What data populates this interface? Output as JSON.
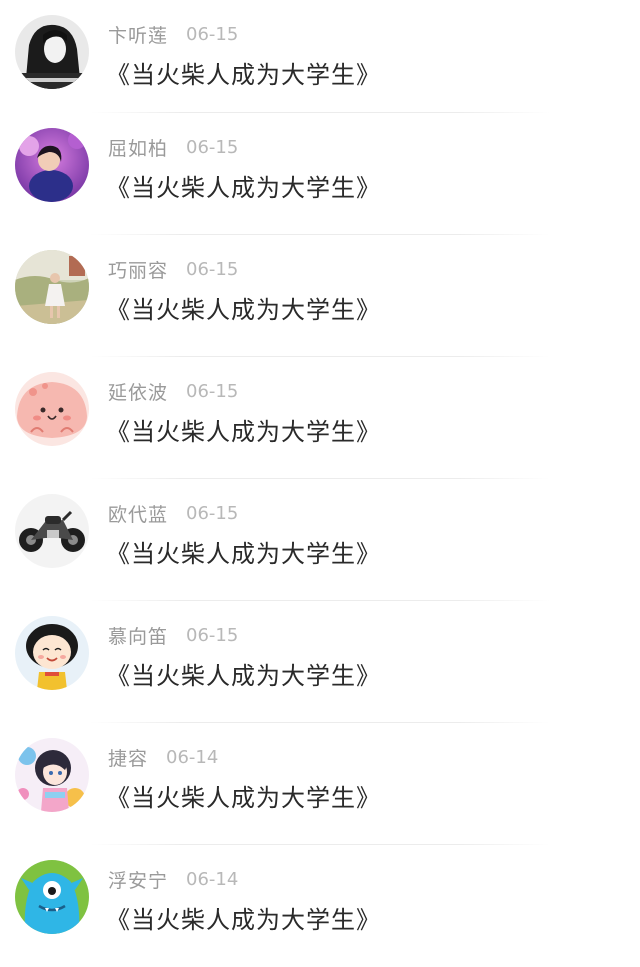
{
  "comments": [
    {
      "name": "卞听莲",
      "date": "06-15",
      "text": "《当火柴人成为大学生》",
      "avatar": "bw-portrait-avatar"
    },
    {
      "name": "屈如柏",
      "date": "06-15",
      "text": "《当火柴人成为大学生》",
      "avatar": "purple-balloons-avatar"
    },
    {
      "name": "巧丽容",
      "date": "06-15",
      "text": "《当火柴人成为大学生》",
      "avatar": "outdoor-girl-avatar"
    },
    {
      "name": "延依波",
      "date": "06-15",
      "text": "《当火柴人成为大学生》",
      "avatar": "pink-cartoon-avatar"
    },
    {
      "name": "欧代蓝",
      "date": "06-15",
      "text": "《当火柴人成为大学生》",
      "avatar": "motorcycle-avatar"
    },
    {
      "name": "慕向笛",
      "date": "06-15",
      "text": "《当火柴人成为大学生》",
      "avatar": "cartoon-girl-avatar"
    },
    {
      "name": "捷容",
      "date": "06-14",
      "text": "《当火柴人成为大学生》",
      "avatar": "anime-girl-avatar"
    },
    {
      "name": "浮安宁",
      "date": "06-14",
      "text": "《当火柴人成为大学生》",
      "avatar": "blue-monster-avatar"
    }
  ],
  "colors": {
    "name": "#9a9a9a",
    "date": "#b8b8b8",
    "text": "#2a2a2a",
    "divider": "#ececec"
  }
}
